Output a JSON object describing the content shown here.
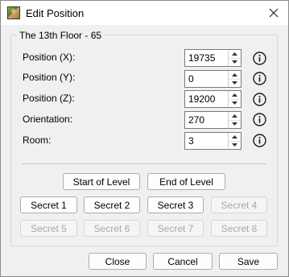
{
  "window": {
    "title": "Edit Position",
    "app_icon": "app-thumbnail-icon",
    "close_icon": "close-icon"
  },
  "group": {
    "title": "The 13th Floor - 65"
  },
  "fields": [
    {
      "label": "Position (X):",
      "value": "19735"
    },
    {
      "label": "Position (Y):",
      "value": "0"
    },
    {
      "label": "Position (Z):",
      "value": "19200"
    },
    {
      "label": "Orientation:",
      "value": "270"
    },
    {
      "label": "Room:",
      "value": "3"
    }
  ],
  "level_buttons": {
    "start": "Start of Level",
    "end": "End of Level"
  },
  "secrets": [
    {
      "label": "Secret 1",
      "enabled": true
    },
    {
      "label": "Secret 2",
      "enabled": true
    },
    {
      "label": "Secret 3",
      "enabled": true
    },
    {
      "label": "Secret 4",
      "enabled": false
    },
    {
      "label": "Secret 5",
      "enabled": false
    },
    {
      "label": "Secret 6",
      "enabled": false
    },
    {
      "label": "Secret 7",
      "enabled": false
    },
    {
      "label": "Secret 8",
      "enabled": false
    }
  ],
  "footer": {
    "close": "Close",
    "cancel": "Cancel",
    "save": "Save"
  },
  "colors": {
    "window_bg": "#f0f0f0",
    "disabled_text": "#a8a8a8"
  }
}
